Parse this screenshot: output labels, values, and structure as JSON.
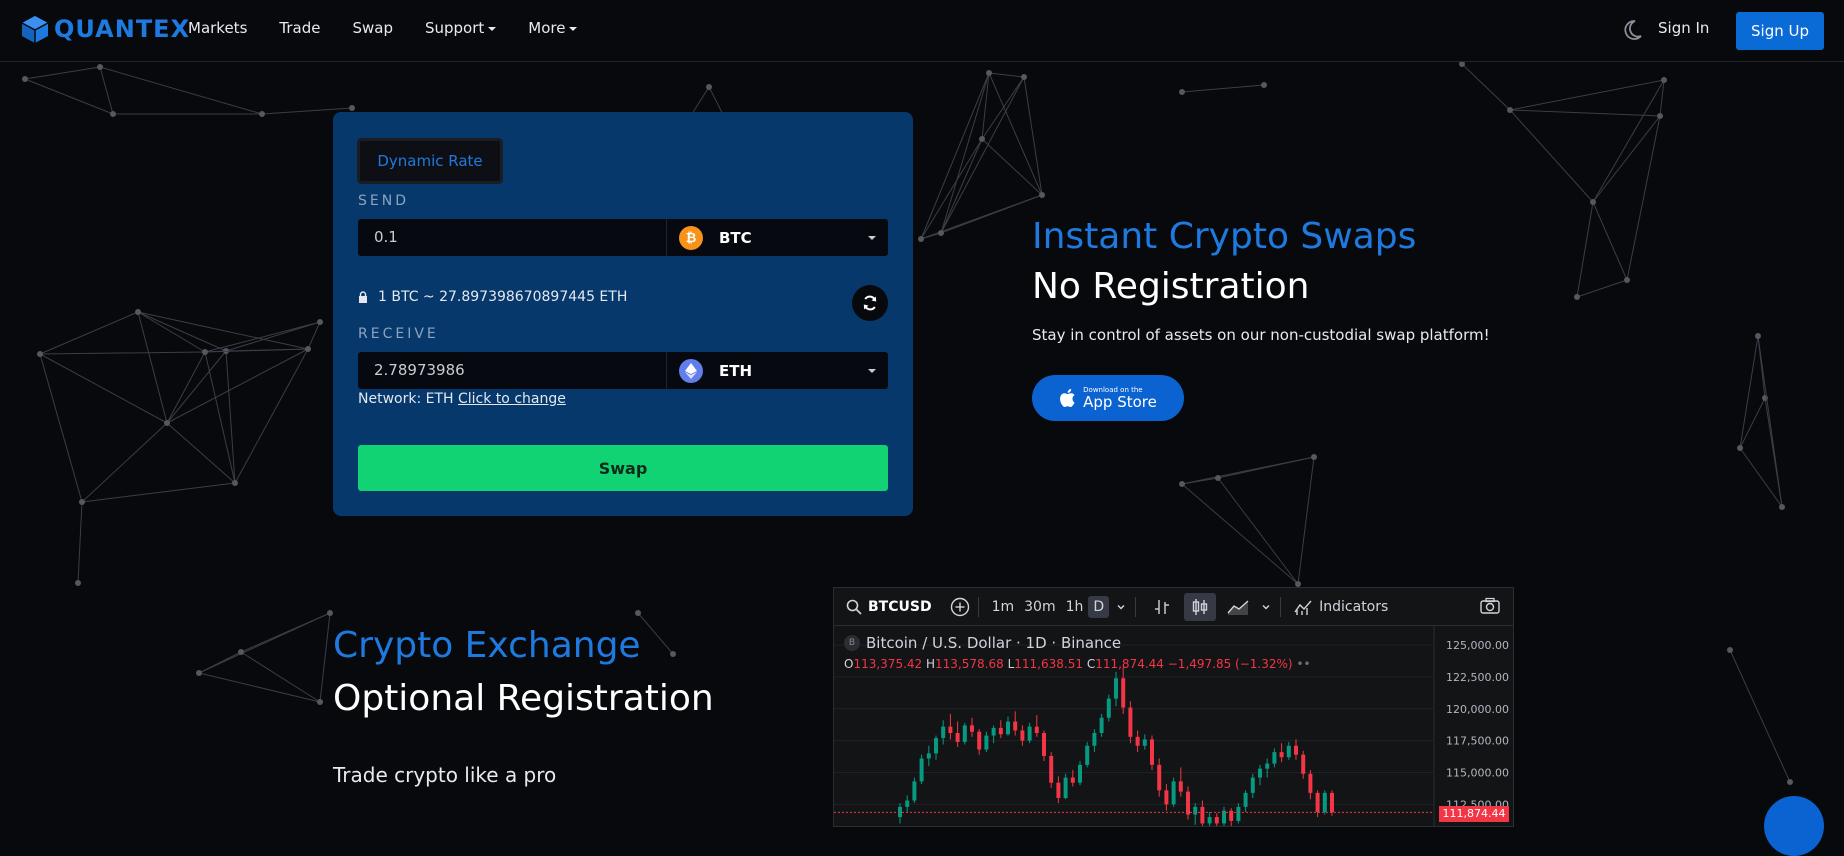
{
  "nav": {
    "brand": "QUANTEX",
    "links": [
      {
        "label": "Markets"
      },
      {
        "label": "Trade"
      },
      {
        "label": "Swap"
      },
      {
        "label": "Support"
      },
      {
        "label": "More"
      }
    ],
    "signin": "Sign In",
    "signup": "Sign Up"
  },
  "swap": {
    "mode": "Dynamic Rate",
    "send_label": "SEND",
    "send_amount": "0.1",
    "send_coin": "BTC",
    "rate": "1 BTC ~ 27.897398670897445 ETH",
    "receive_label": "RECEIVE",
    "receive_amount": "2.78973986",
    "receive_coin": "ETH",
    "network_prefix": "Network: ETH",
    "network_link": "Click to change",
    "swap_button": "Swap"
  },
  "hero": {
    "title_blue": "Instant Crypto Swaps",
    "title_white": "No Registration",
    "subtitle": "Stay in control of assets on our non-custodial swap platform!",
    "appstore_small": "Download on the",
    "appstore_big": "App Store"
  },
  "exchange": {
    "title_blue": "Crypto Exchange",
    "title_white": "Optional Registration",
    "subtitle": "Trade crypto like a pro"
  },
  "widget": {
    "symbol": "BTCUSD",
    "intervals": [
      "1m",
      "30m",
      "1h",
      "D"
    ],
    "active_interval": "D",
    "indicators_label": "Indicators",
    "title": "Bitcoin / U.S. Dollar · 1D · Binance",
    "ohlc": {
      "o_label": "O",
      "o": "113,375.42",
      "h_label": "H",
      "h": "113,578.68",
      "l_label": "L",
      "l": "111,638.51",
      "c_label": "C",
      "c": "111,874.44",
      "change": "−1,497.85 (−1.32%)"
    },
    "last_price": "111,874.44"
  },
  "colors": {
    "accent": "#1f7ae0",
    "card": "#06386c",
    "swap_green": "#11d374",
    "btc": "#f7931a",
    "eth": "#627eea",
    "up": "#089981",
    "down": "#f23645"
  },
  "chart_data": {
    "type": "candlestick",
    "y_ticks": [
      "125,000.00",
      "122,500.00",
      "120,000.00",
      "117,500.00",
      "115,000.00",
      "112,500.00"
    ],
    "ylim": [
      110800,
      126500
    ],
    "candles": [
      [
        111500,
        112600,
        111000,
        112300
      ],
      [
        112300,
        113200,
        111900,
        112800
      ],
      [
        112800,
        114600,
        112600,
        114300
      ],
      [
        114300,
        116400,
        114100,
        116100
      ],
      [
        116100,
        117100,
        115500,
        116500
      ],
      [
        116500,
        117900,
        116000,
        117700
      ],
      [
        117700,
        119100,
        117200,
        118600
      ],
      [
        118600,
        119600,
        117600,
        118100
      ],
      [
        118100,
        119000,
        117000,
        117400
      ],
      [
        117400,
        118900,
        117200,
        118700
      ],
      [
        118700,
        119300,
        117800,
        118200
      ],
      [
        118200,
        118400,
        116400,
        116800
      ],
      [
        116800,
        118200,
        116600,
        117900
      ],
      [
        117900,
        118700,
        117300,
        118500
      ],
      [
        118500,
        119100,
        117700,
        118000
      ],
      [
        118000,
        119400,
        117900,
        119000
      ],
      [
        119000,
        119800,
        117900,
        118300
      ],
      [
        118300,
        118700,
        117100,
        117500
      ],
      [
        117500,
        118900,
        117300,
        118600
      ],
      [
        118600,
        119500,
        117800,
        118100
      ],
      [
        118100,
        118300,
        115900,
        116300
      ],
      [
        116300,
        116600,
        113800,
        114200
      ],
      [
        114200,
        114700,
        112600,
        113000
      ],
      [
        113000,
        114900,
        112900,
        114600
      ],
      [
        114600,
        115200,
        113900,
        114200
      ],
      [
        114200,
        115900,
        114000,
        115600
      ],
      [
        115600,
        117400,
        115400,
        117100
      ],
      [
        117100,
        118400,
        116600,
        118100
      ],
      [
        118100,
        119600,
        117800,
        119300
      ],
      [
        119300,
        121100,
        119000,
        120800
      ],
      [
        120800,
        122900,
        120200,
        122400
      ],
      [
        122400,
        123300,
        119600,
        120100
      ],
      [
        120100,
        120600,
        117300,
        117800
      ],
      [
        117800,
        118300,
        116600,
        117100
      ],
      [
        117100,
        118000,
        116800,
        117600
      ],
      [
        117600,
        117900,
        115200,
        115600
      ],
      [
        115600,
        116100,
        113100,
        113600
      ],
      [
        113600,
        114100,
        112000,
        112500
      ],
      [
        112500,
        114600,
        112300,
        114300
      ],
      [
        114300,
        115400,
        113100,
        113500
      ],
      [
        113500,
        113900,
        111300,
        111700
      ],
      [
        111700,
        112600,
        110900,
        112300
      ],
      [
        112300,
        112800,
        110600,
        111000
      ],
      [
        111000,
        111900,
        110600,
        111500
      ],
      [
        111500,
        111800,
        110700,
        111000
      ],
      [
        111000,
        112300,
        110800,
        112000
      ],
      [
        112000,
        112200,
        110700,
        111200
      ],
      [
        111200,
        112600,
        111000,
        112300
      ],
      [
        112300,
        113600,
        111900,
        113400
      ],
      [
        113400,
        114900,
        113000,
        114600
      ],
      [
        114600,
        115600,
        114000,
        115300
      ],
      [
        115300,
        116100,
        114600,
        115700
      ],
      [
        115700,
        116900,
        115400,
        116600
      ],
      [
        116600,
        117300,
        115800,
        116200
      ],
      [
        116200,
        117400,
        116000,
        117100
      ],
      [
        117100,
        117600,
        116000,
        116400
      ],
      [
        116400,
        116700,
        114500,
        114900
      ],
      [
        114900,
        115200,
        112900,
        113400
      ],
      [
        113400,
        113600,
        111500,
        111900
      ],
      [
        111900,
        113600,
        111700,
        113400
      ],
      [
        113400,
        113600,
        111600,
        111874
      ]
    ]
  }
}
